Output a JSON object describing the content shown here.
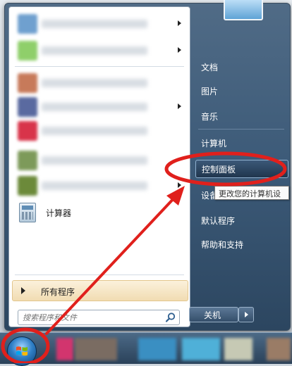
{
  "start_menu": {
    "calculator_label": "计算器",
    "all_programs_label": "所有程序",
    "search_placeholder": "搜索程序和文件",
    "right_items": [
      {
        "label": "文档"
      },
      {
        "label": "图片"
      },
      {
        "label": "音乐"
      },
      {
        "label": "计算机"
      },
      {
        "label": "控制面板"
      },
      {
        "label": "设备和"
      },
      {
        "label": "默认程序"
      },
      {
        "label": "帮助和支持"
      }
    ],
    "tooltip": "更改您的计算机设",
    "shutdown_label": "关机"
  },
  "annotation": {
    "color": "#e0201c"
  },
  "icons": {
    "search": "magnifier-icon",
    "start": "windows-logo-icon"
  }
}
